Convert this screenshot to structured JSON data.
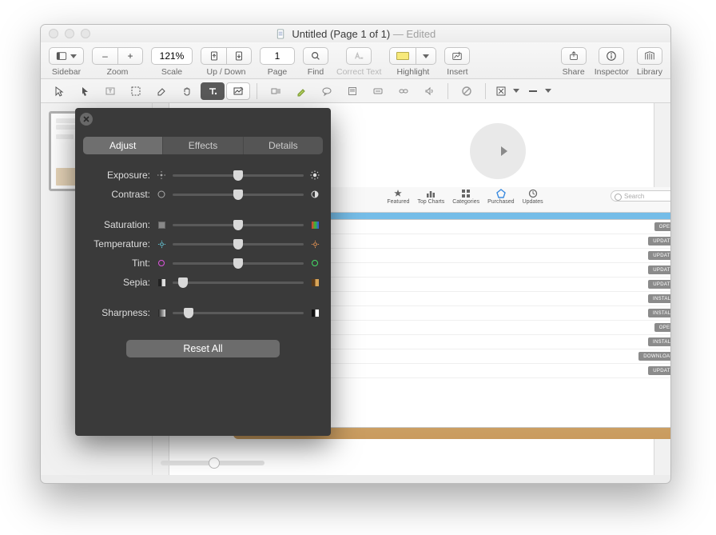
{
  "title": {
    "name": "Untitled",
    "pages": "(Page 1 of 1)",
    "edited": "— Edited"
  },
  "toolbar": {
    "sidebar": "Sidebar",
    "zoom": "Zoom",
    "zoom_minus": "–",
    "zoom_plus": "+",
    "scale": "Scale",
    "scale_value": "121%",
    "updown": "Up / Down",
    "page": "Page",
    "page_value": "1",
    "find": "Find",
    "correct": "Correct Text",
    "highlight": "Highlight",
    "insert": "Insert",
    "share": "Share",
    "inspector": "Inspector",
    "library": "Library"
  },
  "panel": {
    "tabs": {
      "adjust": "Adjust",
      "effects": "Effects",
      "details": "Details"
    },
    "sliders": {
      "exposure": {
        "label": "Exposure:",
        "pos": 50
      },
      "contrast": {
        "label": "Contrast:",
        "pos": 50
      },
      "saturation": {
        "label": "Saturation:",
        "pos": 50
      },
      "temperature": {
        "label": "Temperature:",
        "pos": 50
      },
      "tint": {
        "label": "Tint:",
        "pos": 50
      },
      "sepia": {
        "label": "Sepia:",
        "pos": 8
      },
      "sharpness": {
        "label": "Sharpness:",
        "pos": 12
      }
    },
    "reset": "Reset All"
  },
  "embedded": {
    "tabs": [
      "Featured",
      "Top Charts",
      "Categories",
      "Purchased",
      "Updates"
    ],
    "search_placeholder": "Search",
    "buttons": [
      "OPEN",
      "UPDATE",
      "UPDATE",
      "UPDATE",
      "UPDATE",
      "INSTALL",
      "INSTALL",
      "OPEN",
      "INSTALL",
      "DOWNLOAD",
      "UPDATE"
    ]
  }
}
